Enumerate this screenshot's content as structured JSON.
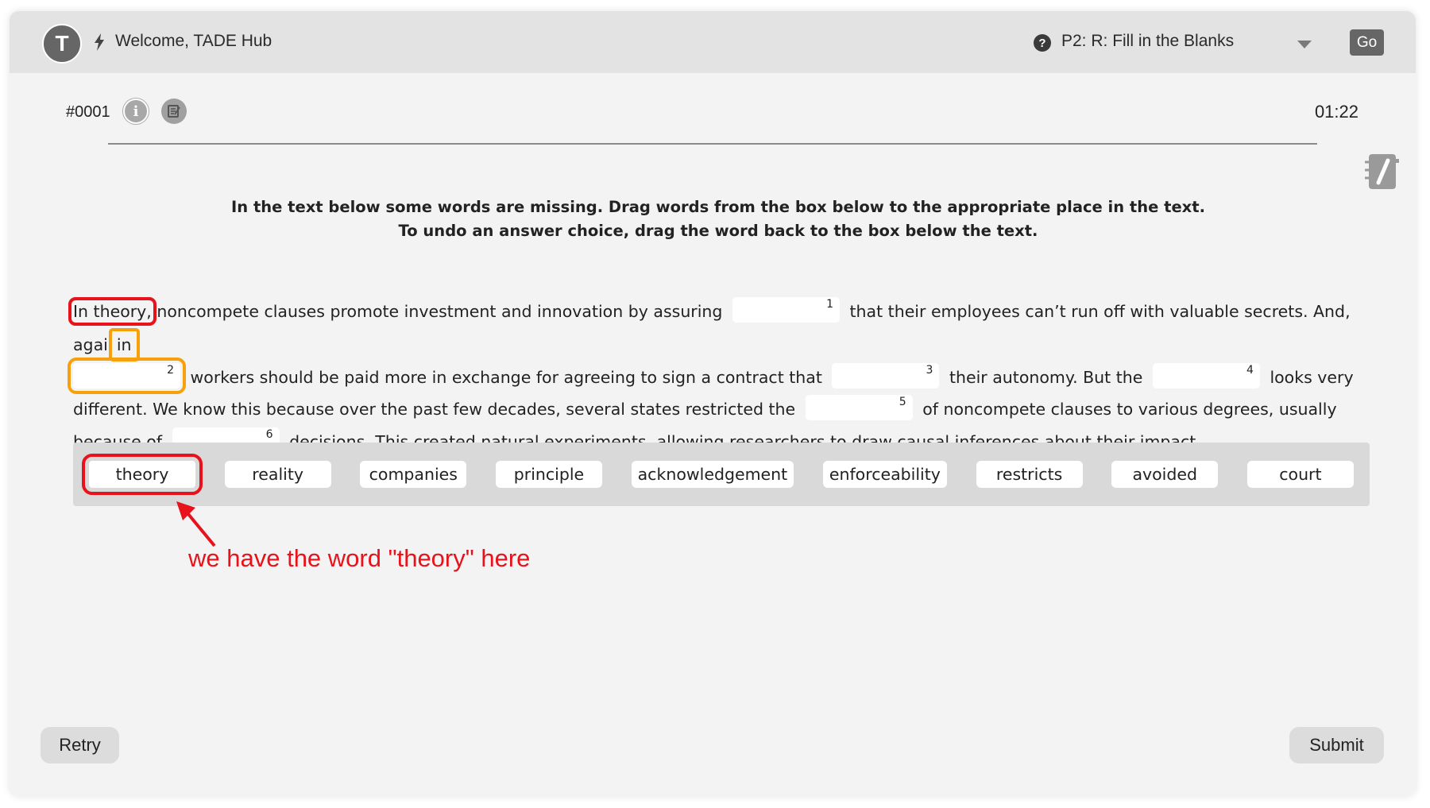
{
  "header": {
    "avatar_letter": "T",
    "welcome_text": "Welcome, TADE Hub",
    "question_type": "P2: R: Fill in the Blanks",
    "go_label": "Go",
    "help_glyph": "?"
  },
  "question": {
    "id": "#0001",
    "timer": "01:22",
    "info_glyph": "i"
  },
  "instructions": {
    "line1": "In the text below some words are missing. Drag words from the box below to the appropriate place in the text.",
    "line2": "To undo an answer choice, drag the word back to the box below the text."
  },
  "passage": {
    "seg0": "In theory,",
    "seg1": " noncompete clauses promote investment and innovation by assuring",
    "seg2": "that their employees can’t run off with valuable secrets. And, again",
    "seg2b": "in",
    "seg3": "workers should be paid more in exchange for agreeing to sign a contract that",
    "seg4": "their autonomy. But the",
    "seg5": "looks very different. We know this because over the past few decades, several states restricted the",
    "seg6": "of noncompete clauses to various degrees, usually because of",
    "seg7": "decisions. This created natural experiments, allowing researchers to draw causal inferences about their impact.",
    "blanks": [
      {
        "number": "1",
        "value": ""
      },
      {
        "number": "2",
        "value": ""
      },
      {
        "number": "3",
        "value": ""
      },
      {
        "number": "4",
        "value": ""
      },
      {
        "number": "5",
        "value": ""
      },
      {
        "number": "6",
        "value": ""
      }
    ]
  },
  "word_bank": [
    "theory",
    "reality",
    "companies",
    "principle",
    "acknowledgement",
    "enforceability",
    "restricts",
    "avoided",
    "court"
  ],
  "annotation": {
    "text": "we have the word \"theory\" here",
    "color": "#e8121a"
  },
  "highlight_colors": {
    "red": "#e8121a",
    "orange": "#f6a00c"
  },
  "footer": {
    "retry_label": "Retry",
    "submit_label": "Submit"
  }
}
